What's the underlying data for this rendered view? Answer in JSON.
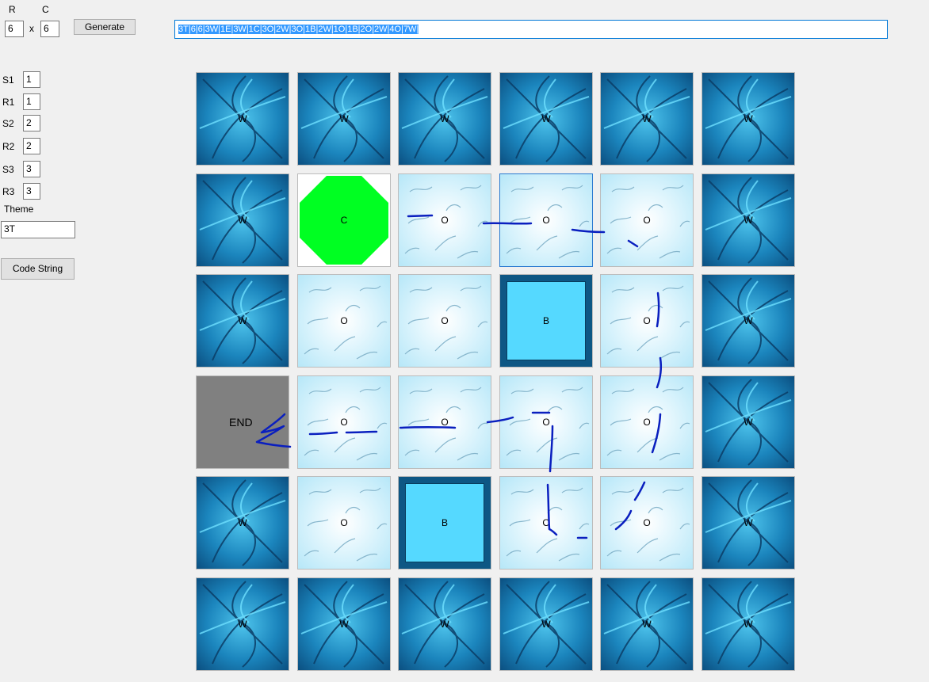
{
  "header": {
    "rows_label": "R",
    "cols_label": "C",
    "rows_value": "6",
    "cols_value": "6",
    "times_sign": "x",
    "generate_label": "Generate",
    "code_string_value": "3T|6|6|3W|1E|3W|1C|3O|2W|3O|1B|2W|1O|1B|2O|2W|4O|7W|"
  },
  "sidebar": {
    "fields": [
      {
        "label": "S1",
        "value": "1"
      },
      {
        "label": "R1",
        "value": "1"
      },
      {
        "label": "S2",
        "value": "2"
      },
      {
        "label": "R2",
        "value": "2"
      },
      {
        "label": "S3",
        "value": "3"
      },
      {
        "label": "R3",
        "value": "3"
      }
    ],
    "theme_label": "Theme",
    "theme_value": "3T",
    "code_string_button": "Code String"
  },
  "board": {
    "rows": [
      [
        {
          "type": "wall",
          "label": "W"
        },
        {
          "type": "wall",
          "label": "W"
        },
        {
          "type": "wall",
          "label": "W"
        },
        {
          "type": "wall",
          "label": "W"
        },
        {
          "type": "wall",
          "label": "W"
        },
        {
          "type": "wall",
          "label": "W"
        }
      ],
      [
        {
          "type": "wall",
          "label": "W"
        },
        {
          "type": "start",
          "label": "C"
        },
        {
          "type": "water",
          "label": "O"
        },
        {
          "type": "water",
          "label": "O",
          "selected": true
        },
        {
          "type": "water",
          "label": "O"
        },
        {
          "type": "wall",
          "label": "W"
        }
      ],
      [
        {
          "type": "wall",
          "label": "W"
        },
        {
          "type": "water",
          "label": "O"
        },
        {
          "type": "water",
          "label": "O"
        },
        {
          "type": "block",
          "label": "B"
        },
        {
          "type": "water",
          "label": "O"
        },
        {
          "type": "wall",
          "label": "W"
        }
      ],
      [
        {
          "type": "end",
          "label": "END"
        },
        {
          "type": "water",
          "label": "O"
        },
        {
          "type": "water",
          "label": "O"
        },
        {
          "type": "water",
          "label": "O"
        },
        {
          "type": "water",
          "label": "O"
        },
        {
          "type": "wall",
          "label": "W"
        }
      ],
      [
        {
          "type": "wall",
          "label": "W"
        },
        {
          "type": "water",
          "label": "O"
        },
        {
          "type": "block",
          "label": "B"
        },
        {
          "type": "water",
          "label": "O"
        },
        {
          "type": "water",
          "label": "O"
        },
        {
          "type": "wall",
          "label": "W"
        }
      ],
      [
        {
          "type": "wall",
          "label": "W"
        },
        {
          "type": "wall",
          "label": "W"
        },
        {
          "type": "wall",
          "label": "W"
        },
        {
          "type": "wall",
          "label": "W"
        },
        {
          "type": "wall",
          "label": "W"
        },
        {
          "type": "wall",
          "label": "W"
        }
      ]
    ]
  },
  "colors": {
    "start_octagon": "#00ff22",
    "scribble": "#0a1fbf",
    "selection": "#3399ff"
  }
}
